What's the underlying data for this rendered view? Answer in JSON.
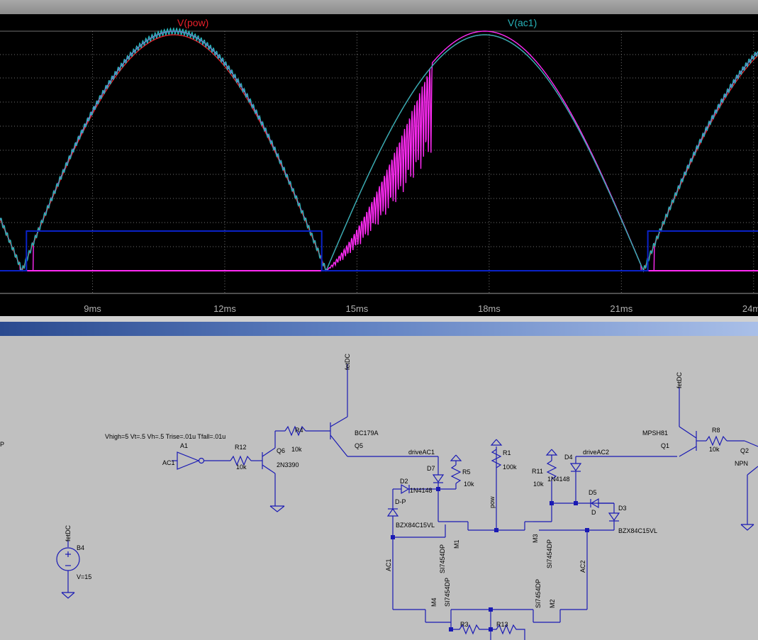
{
  "colors": {
    "plot_background": "#000000",
    "grid": "#707070",
    "pow": "#e8202a",
    "ac1": "#27b2b8",
    "drive": "#ff2af5",
    "blue_trace": "#0a22c8",
    "wire": "#1a1ab4"
  },
  "plot": {
    "legend": {
      "pow_label": "V(pow)",
      "ac1_label": "V(ac1)"
    }
  },
  "chart_data": {
    "type": "line",
    "x_unit": "ms",
    "x_ticks": [
      "9ms",
      "12ms",
      "15ms",
      "18ms",
      "21ms",
      "24ms"
    ],
    "xlim": [
      6.9,
      24.1
    ],
    "series": [
      {
        "name": "V(pow)",
        "color": "#e8202a"
      },
      {
        "name": "V(ac1)",
        "color": "#27b2b8"
      }
    ],
    "grid": true,
    "legend": "top"
  },
  "schematic": {
    "labels": {
      "p_fragment": "P",
      "a1": "A1",
      "ac1_node": "AC1",
      "vhigh": "Vhigh=5 Vt=.5 Vh=.5 Trise=.01u Tfall=.01u",
      "r12": "R12",
      "r12_val": "10k",
      "q6": "Q6",
      "q6_model": "2N3390",
      "r4": "R4",
      "r4_val": "10k",
      "q5_model": "BC179A",
      "q5": "Q5",
      "fetdc_1": "fetDC",
      "driveac1": "driveAC1",
      "d7": "D7",
      "r5": "R5",
      "r5_val": "10k",
      "d2": "D2",
      "d2_model": "1N4148",
      "d_p": "D-P",
      "bzx_left": "BZX84C15VL",
      "m1": "M1",
      "si_m1": "SI7454DP",
      "ac1_wire": "AC1",
      "si_m4": "SI7454DP",
      "m4": "M4",
      "r3": "R3",
      "r1": "R1",
      "r1_val": "100k",
      "pow": "pow",
      "r13": "R13",
      "r11": "R11",
      "r11_val": "10k",
      "d4": "D4",
      "d4_model": "1N4148",
      "driveac2": "driveAC2",
      "d5": "D5",
      "d5_model": "D",
      "d3": "D3",
      "bzx_right": "BZX84C15VL",
      "m3": "M3",
      "si_m3": "SI7454DP",
      "ac2_wire": "AC2",
      "si_m2": "SI7454DP",
      "m2": "M2",
      "fetdc_2": "fetDC",
      "mpsh81": "MPSH81",
      "q1": "Q1",
      "r8": "R8",
      "r8_val": "10k",
      "q2": "Q2",
      "npn": "NPN",
      "b4": "B4",
      "fetdc_3": "fetDC",
      "v15": "V=15"
    }
  }
}
